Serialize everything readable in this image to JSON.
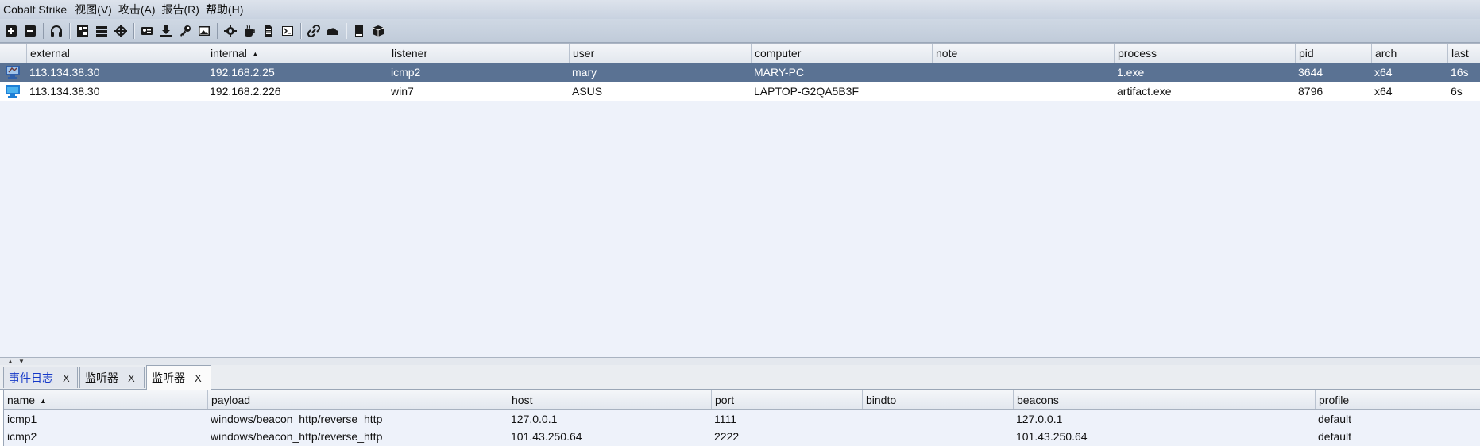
{
  "menubar": {
    "app_title": "Cobalt Strike",
    "items": [
      "视图(V)",
      "攻击(A)",
      "报告(R)",
      "帮助(H)"
    ]
  },
  "toolbar": {
    "icons": [
      "plus-icon",
      "minus-icon",
      "headphones-icon",
      "pivot-graph-icon",
      "session-list-icon",
      "target-crosshair-icon",
      "credentials-icon",
      "download-icon",
      "key-icon",
      "screenshot-icon",
      "gear-icon",
      "coffee-icon",
      "document-icon",
      "terminal-icon",
      "link-icon",
      "cloud-icon",
      "book-icon",
      "cube-icon"
    ]
  },
  "sessions": {
    "columns": [
      "",
      "external",
      "internal",
      "listener",
      "user",
      "computer",
      "note",
      "process",
      "pid",
      "arch",
      "last"
    ],
    "sorted_column": "internal",
    "rows": [
      {
        "external": "113.134.38.30",
        "internal": "192.168.2.25",
        "listener": "icmp2",
        "user": "mary",
        "computer": "MARY-PC",
        "note": "",
        "process": "1.exe",
        "pid": "3644",
        "arch": "x64",
        "last": "16s",
        "selected": true
      },
      {
        "external": "113.134.38.30",
        "internal": "192.168.2.226",
        "listener": "win7",
        "user": "ASUS",
        "computer": "LAPTOP-G2QA5B3F",
        "note": "",
        "process": "artifact.exe",
        "pid": "8796",
        "arch": "x64",
        "last": "6s",
        "selected": false
      }
    ]
  },
  "tabs": [
    {
      "label": "事件日志",
      "close": "X",
      "active": false
    },
    {
      "label": "监听器",
      "close": "X",
      "active": false
    },
    {
      "label": "监听器",
      "close": "X",
      "active": true
    }
  ],
  "listeners": {
    "columns": [
      "name",
      "payload",
      "host",
      "port",
      "bindto",
      "beacons",
      "profile"
    ],
    "sorted_column": "name",
    "rows": [
      {
        "name": "icmp1",
        "payload": "windows/beacon_http/reverse_http",
        "host": "127.0.0.1",
        "port": "1111",
        "bindto": "",
        "beacons": "127.0.0.1",
        "profile": "default"
      },
      {
        "name": "icmp2",
        "payload": "windows/beacon_http/reverse_http",
        "host": "101.43.250.64",
        "port": "2222",
        "bindto": "",
        "beacons": "101.43.250.64",
        "profile": "default"
      }
    ]
  },
  "colors": {
    "selected_row": "#5a7293",
    "table_bg": "#eef2fa",
    "tab_blue_text": "#1438c8"
  }
}
